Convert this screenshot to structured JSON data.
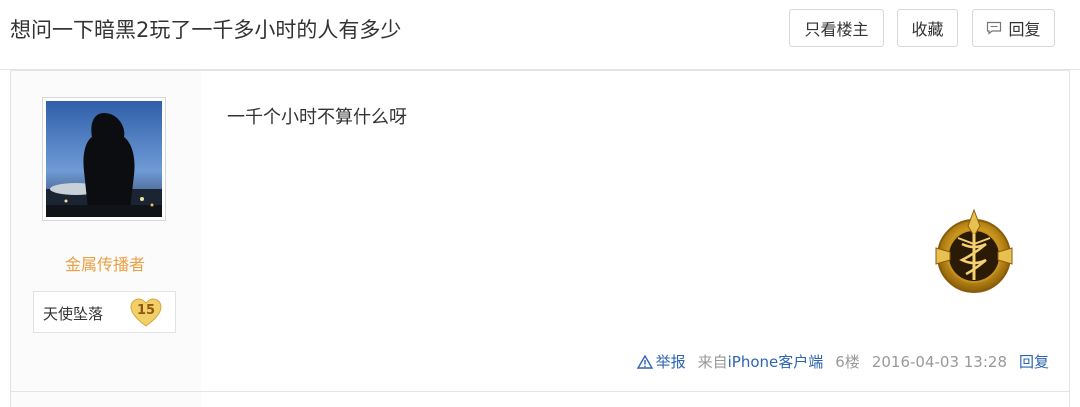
{
  "thread": {
    "title": "想问一下暗黑2玩了一千多小时的人有多少"
  },
  "toolbar": {
    "only_author_label": "只看楼主",
    "favorite_label": "收藏",
    "reply_label": "回复"
  },
  "post": {
    "author": {
      "username": "金属传播者",
      "badge_name": "天使坠落",
      "badge_level": "15"
    },
    "content": "一千个小时不算什么呀",
    "footer": {
      "report_label": "举报",
      "source_prefix": "来自",
      "source_client": "iPhone客户端",
      "floor": "6楼",
      "timestamp": "2016-04-03 13:28",
      "reply_label": "回复"
    }
  },
  "colors": {
    "username": "#e9a043",
    "link": "#2d64b3",
    "meta": "#999999"
  }
}
